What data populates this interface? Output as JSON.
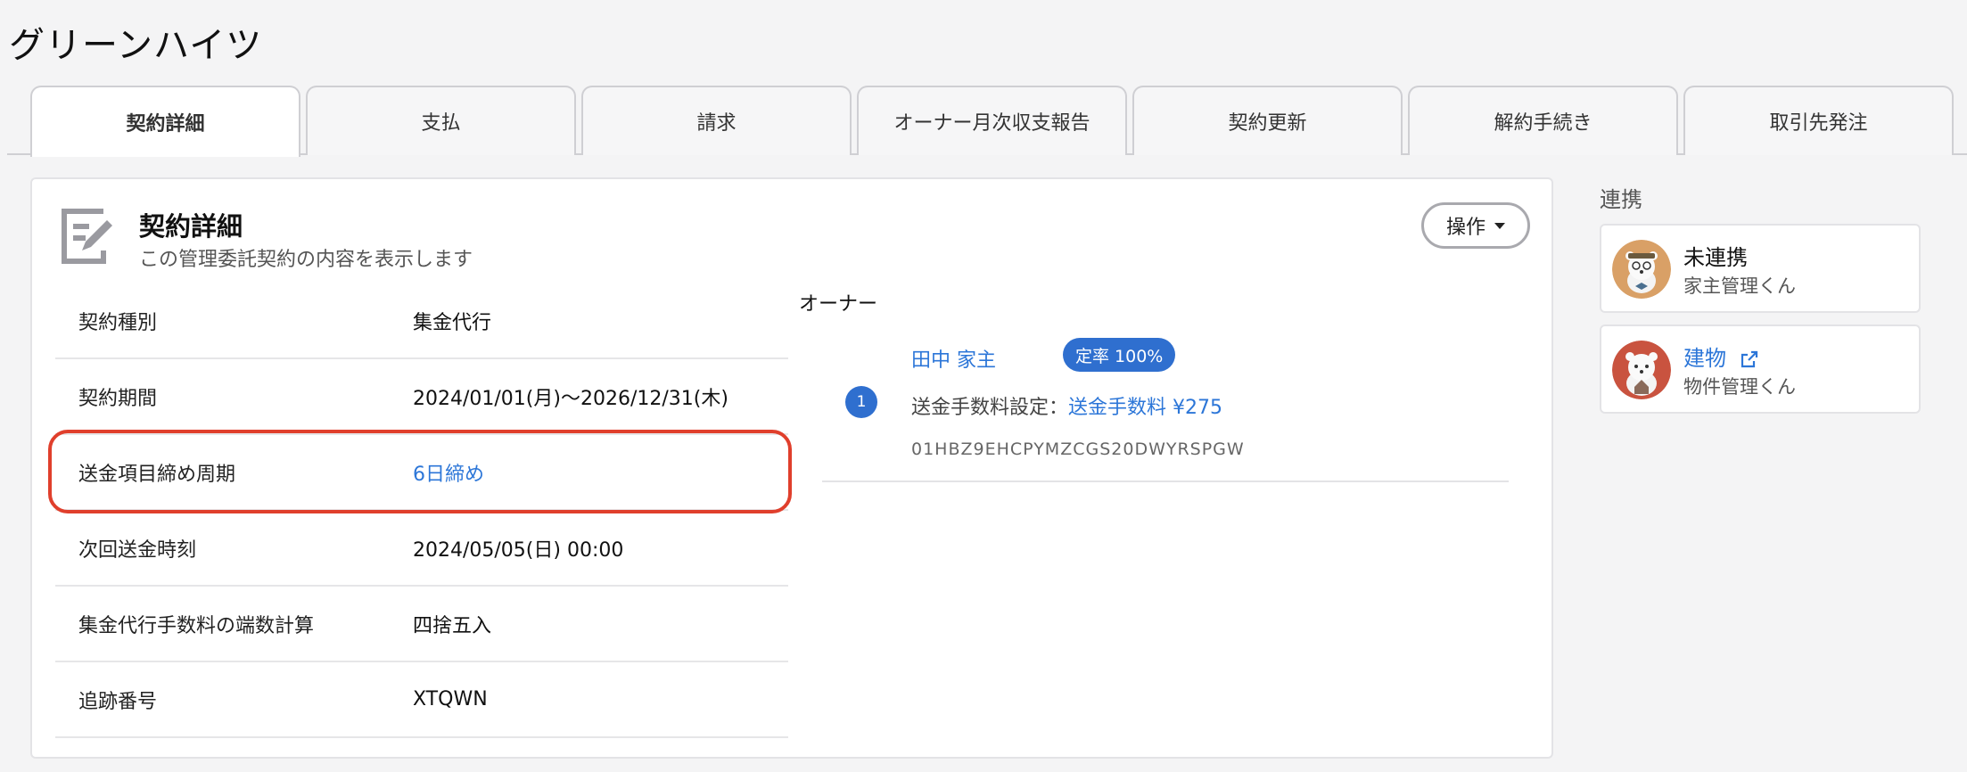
{
  "page": {
    "title": "グリーンハイツ"
  },
  "tabs": [
    {
      "label": "契約詳細",
      "active": true
    },
    {
      "label": "支払"
    },
    {
      "label": "請求"
    },
    {
      "label": "オーナー月次収支報告"
    },
    {
      "label": "契約更新"
    },
    {
      "label": "解約手続き"
    },
    {
      "label": "取引先発注"
    }
  ],
  "card": {
    "title": "契約詳細",
    "description": "この管理委託契約の内容を表示します",
    "ops_label": "操作",
    "icon": "edit-document-icon"
  },
  "details": [
    {
      "label": "契約種別",
      "value": "集金代行"
    },
    {
      "label": "契約期間",
      "value": "2024/01/01(月)～2026/12/31(木)"
    },
    {
      "label": "送金項目締め周期",
      "value": "6日締め",
      "link": true,
      "highlighted": true
    },
    {
      "label": "次回送金時刻",
      "value": "2024/05/05(日) 00:00"
    },
    {
      "label": "集金代行手数料の端数計算",
      "value": "四捨五入"
    },
    {
      "label": "追跡番号",
      "value": "XTQWN"
    }
  ],
  "owner": {
    "section_label": "オーナー",
    "index": "1",
    "name": "田中 家主",
    "rate_badge": "定率 100%",
    "fee_label": "送金手数料設定：",
    "fee_value": "送金手数料 ¥275",
    "id": "01HBZ9EHCPYMZCGS20DWYRSPGW"
  },
  "integrations": {
    "label": "連携",
    "items": [
      {
        "title": "未連携",
        "subtitle": "家主管理くん",
        "link": false
      },
      {
        "title": "建物",
        "subtitle": "物件管理くん",
        "link": true
      }
    ]
  },
  "colors": {
    "accent": "#2f6fcf",
    "link": "#2c76d8",
    "highlight": "#e03f2c"
  }
}
